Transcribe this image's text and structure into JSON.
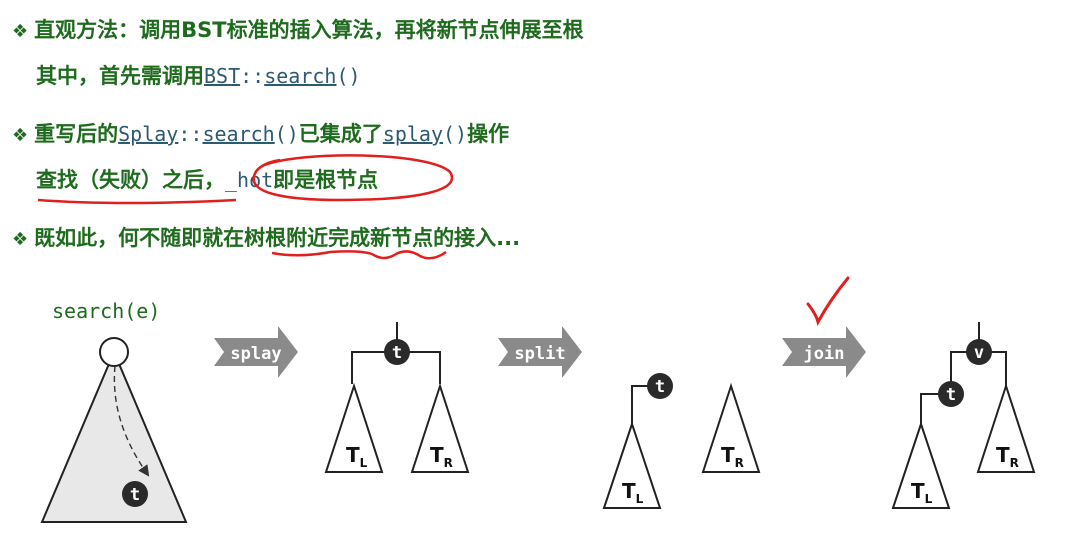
{
  "bullets": {
    "b1": {
      "icon": "diamond-bullet-icon",
      "line1": "直观方法：调用BST标准的插入算法，再将新节点伸展至根",
      "line2_prefix": "其中，首先需调用",
      "line2_code_a": "BST",
      "line2_code_sep": "::",
      "line2_code_b": "search",
      "line2_code_c": "()"
    },
    "b2": {
      "icon": "diamond-bullet-icon",
      "prefix": "重写后的",
      "code_a": "Splay",
      "code_sep": "::",
      "code_b": "search",
      "code_c": "()",
      "mid": "已集成了",
      "code_d": "splay",
      "code_e": "()",
      "suffix": "操作",
      "line2_prefix": "查找（失败）之后，",
      "line2_code": "_hot",
      "line2_suffix": "即是根节点"
    },
    "b3": {
      "icon": "diamond-bullet-icon",
      "text": "既如此，何不随即就在树根附近完成新节点的接入..."
    }
  },
  "diagram": {
    "search_label": "search(e)",
    "arrow_splay": "splay",
    "arrow_split": "split",
    "arrow_join": "join",
    "node_t": "t",
    "node_v": "v",
    "sub_TL_T": "T",
    "sub_TL_L": "L",
    "sub_TR_T": "T",
    "sub_TR_R": "R"
  },
  "colors": {
    "text_green": "#1e6b1e",
    "code_blue": "#2c5a70",
    "annotation_red": "#e0201e",
    "arrow_grey": "#8a8a8a",
    "node_dark": "#2a2a2a"
  }
}
